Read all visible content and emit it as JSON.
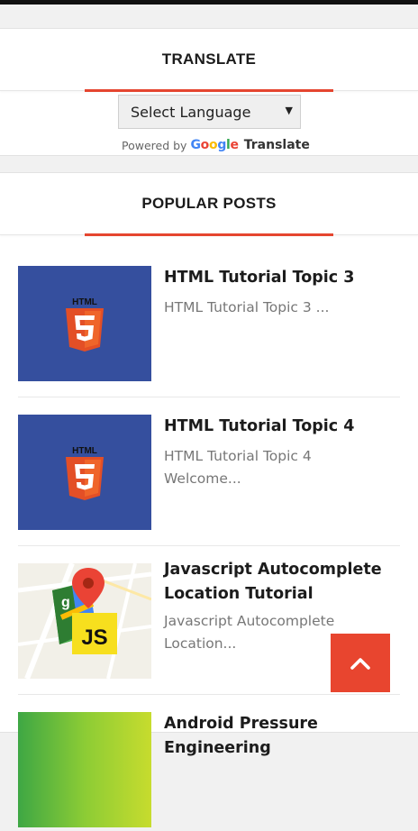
{
  "translate_widget": {
    "title": "TRANSLATE",
    "select_value": "Select Language",
    "powered_by": "Powered by",
    "google_letters": [
      "G",
      "o",
      "o",
      "g",
      "l",
      "e"
    ],
    "translate_word": "Translate"
  },
  "popular_posts": {
    "title": "POPULAR POSTS",
    "items": [
      {
        "title": "HTML Tutorial Topic 3",
        "excerpt_line1": "HTML Tutorial Topic 3 ...",
        "excerpt_line2": "",
        "thumb_label": "HTML"
      },
      {
        "title": "HTML Tutorial Topic 4",
        "excerpt_line1": "HTML Tutorial Topic 4",
        "excerpt_line2": "Welcome...",
        "thumb_label": "HTML"
      },
      {
        "title_line1": "Javascript Autocomplete",
        "title_line2": "Location Tutorial",
        "excerpt_line1": "Javascript Autocomplete",
        "excerpt_line2": "Location...",
        "thumb_label": "JS"
      },
      {
        "title": "Android Pressure Engineering"
      }
    ]
  },
  "colors": {
    "accent": "#e8452f",
    "html_thumb_bg": "#354f9e"
  },
  "icons": {
    "scroll_top": "chevron-up-icon",
    "caret": "caret-down-icon"
  }
}
